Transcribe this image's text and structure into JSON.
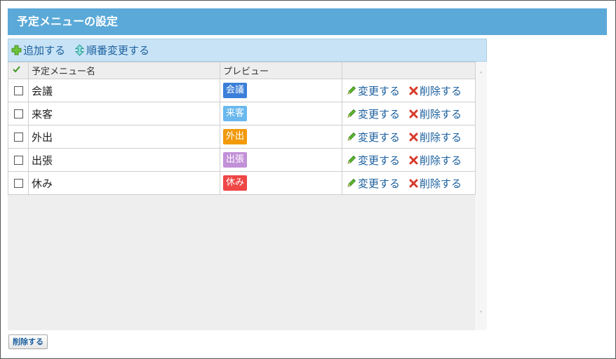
{
  "page": {
    "title": "予定メニューの設定"
  },
  "toolbar": {
    "add_label": "追加する",
    "reorder_label": "順番変更する"
  },
  "table": {
    "headers": {
      "name": "予定メニュー名",
      "preview": "プレビュー"
    },
    "rows": [
      {
        "name": "会議",
        "preview": "会議",
        "color": "#3b7fd9",
        "edit": "変更する",
        "delete": "削除する"
      },
      {
        "name": "来客",
        "preview": "来客",
        "color": "#6ab8ee",
        "edit": "変更する",
        "delete": "削除する"
      },
      {
        "name": "外出",
        "preview": "外出",
        "color": "#f29a0c",
        "edit": "変更する",
        "delete": "削除する"
      },
      {
        "name": "出張",
        "preview": "出張",
        "color": "#c290d8",
        "edit": "変更する",
        "delete": "削除する"
      },
      {
        "name": "休み",
        "preview": "休み",
        "color": "#ef4646",
        "edit": "変更する",
        "delete": "削除する"
      }
    ]
  },
  "footer": {
    "delete_button": "削除する"
  },
  "icons": {
    "add": "plus-icon",
    "reorder": "up-down-arrow-icon",
    "check_all": "checkmark-icon",
    "edit": "pencil-icon",
    "delete": "x-icon",
    "scroll_up": "chevron-up-icon",
    "scroll_down": "chevron-down-icon"
  }
}
